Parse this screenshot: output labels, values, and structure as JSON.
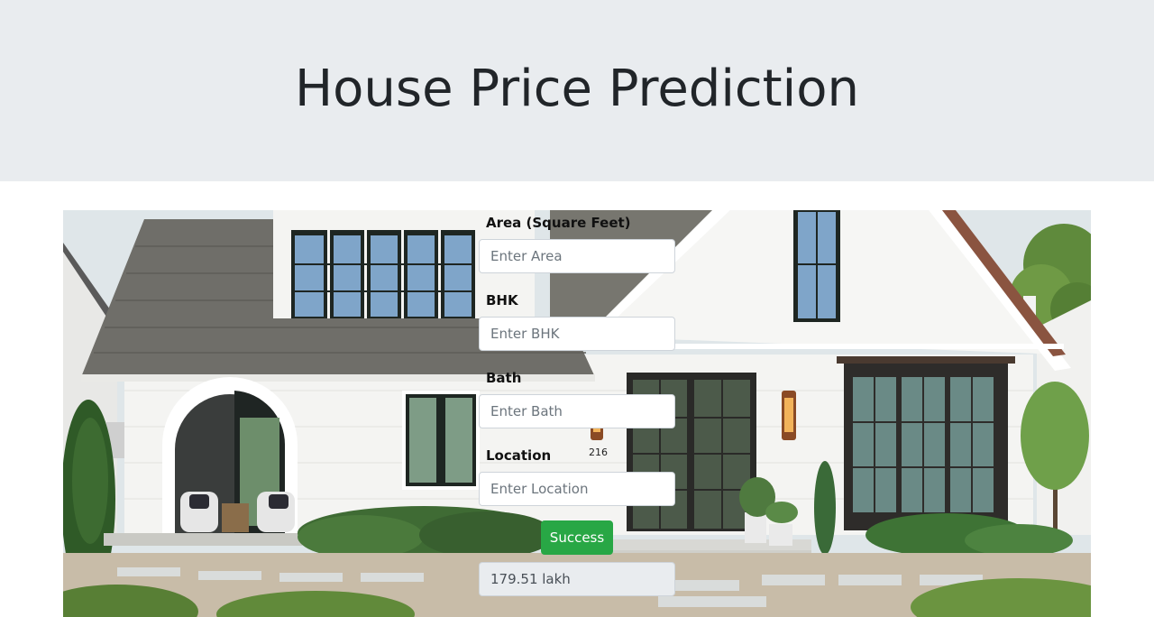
{
  "header": {
    "title": "House Price Prediction"
  },
  "hero": {
    "house_number": "216"
  },
  "form": {
    "area": {
      "label": "Area (Square Feet)",
      "placeholder": "Enter Area"
    },
    "bhk": {
      "label": "BHK",
      "placeholder": "Enter BHK"
    },
    "bath": {
      "label": "Bath",
      "placeholder": "Enter Bath"
    },
    "location": {
      "label": "Location",
      "placeholder": "Enter Location"
    },
    "submit_label": "Success",
    "result": "179.51 lakh"
  },
  "colors": {
    "header_bg": "#e9ecef",
    "button_bg": "#28a745",
    "text": "#212529"
  }
}
